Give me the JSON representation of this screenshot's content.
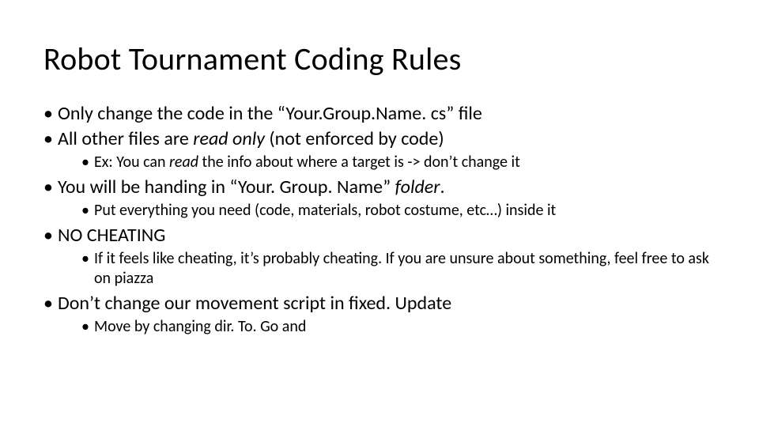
{
  "title": "Robot Tournament Coding Rules",
  "b1_pre": "Only change the code in the “Your.Group.Name. cs” file",
  "b2_pre": "All other files are ",
  "b2_em": "read only",
  "b2_post": " (not enforced by code)",
  "b2_sub1_pre": "Ex: You can ",
  "b2_sub1_em": "read",
  "b2_sub1_post": " the info about where a target is -> don’t change it",
  "b3_pre": "You will be handing in “Your. Group. Name” ",
  "b3_em": "folder",
  "b3_post": ".",
  "b3_sub1": "Put everything you need (code, materials, robot costume, etc…) inside it",
  "b4": "NO CHEATING",
  "b4_sub1": "If it feels like cheating, it’s probably cheating. If you are unsure about something, feel free to ask on piazza",
  "b5": "Don’t change our movement script in fixed. Update",
  "b5_sub1": "Move by changing dir. To. Go and"
}
